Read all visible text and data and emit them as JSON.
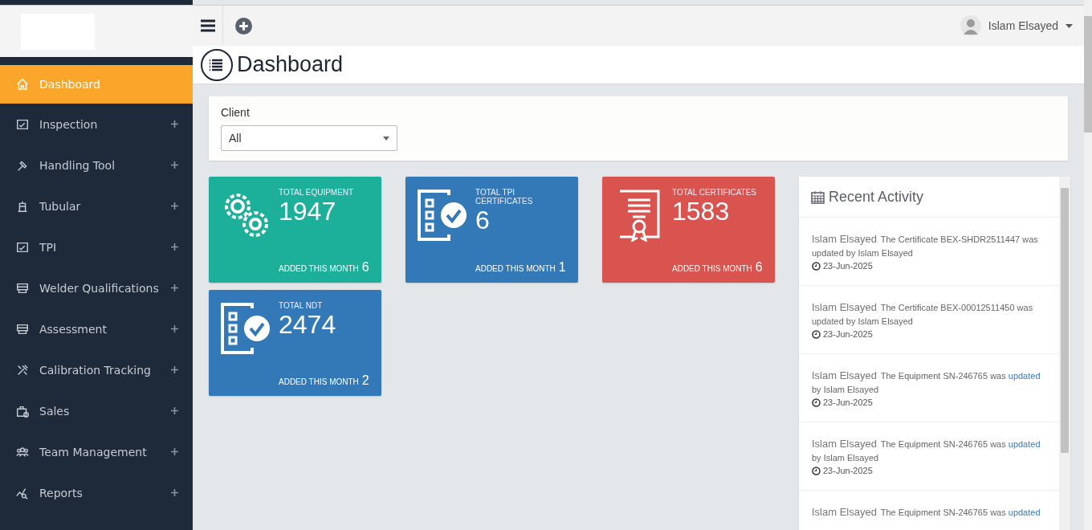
{
  "sidebar": {
    "items": [
      {
        "label": "Dashboard",
        "selected": true,
        "expandable": false
      },
      {
        "label": "Inspection",
        "selected": false,
        "expandable": true
      },
      {
        "label": "Handling Tool",
        "selected": false,
        "expandable": true
      },
      {
        "label": "Tubular",
        "selected": false,
        "expandable": true
      },
      {
        "label": "TPI",
        "selected": false,
        "expandable": true
      },
      {
        "label": "Welder Qualifications",
        "selected": false,
        "expandable": true
      },
      {
        "label": "Assessment",
        "selected": false,
        "expandable": true
      },
      {
        "label": "Calibration Tracking",
        "selected": false,
        "expandable": true
      },
      {
        "label": "Sales",
        "selected": false,
        "expandable": true
      },
      {
        "label": "Team Management",
        "selected": false,
        "expandable": true
      },
      {
        "label": "Reports",
        "selected": false,
        "expandable": true
      }
    ]
  },
  "topbar": {
    "user": "Islam Elsayed"
  },
  "page_title": "Dashboard",
  "filter": {
    "label": "Client",
    "value": "All"
  },
  "stats": [
    {
      "kind": "gears",
      "color": "#1cb09a",
      "title": "TOTAL EQUIPMENT",
      "value": "1947",
      "added_label": "ADDED THIS MONTH",
      "added": "6"
    },
    {
      "kind": "checklist",
      "color": "#3479b7",
      "title": "TOTAL TPI CERTIFICATES",
      "value": "6",
      "added_label": "ADDED THIS MONTH",
      "added": "1"
    },
    {
      "kind": "certificate",
      "color": "#d9534f",
      "title": "TOTAL CERTIFICATES",
      "value": "1583",
      "added_label": "ADDED THIS MONTH",
      "added": "6"
    },
    {
      "kind": "checklist",
      "color": "#3479b7",
      "title": "TOTAL NDT",
      "value": "2474",
      "added_label": "ADDED THIS MONTH",
      "added": "2"
    }
  ],
  "activity": {
    "title": "Recent Activity",
    "items": [
      {
        "user": "Islam Elsayed",
        "parts": [
          {
            "kind": "plain",
            "text": "The Certificate BEX-SHDR2511447 was updated by Islam Elsayed"
          }
        ],
        "date": "23-Jun-2025"
      },
      {
        "user": "Islam Elsayed",
        "parts": [
          {
            "kind": "plain",
            "text": "The Certificate BEX-00012511450 was updated by Islam Elsayed"
          }
        ],
        "date": "23-Jun-2025"
      },
      {
        "user": "Islam Elsayed",
        "parts": [
          {
            "kind": "plain",
            "text": "The Equipment SN-246765 was"
          },
          {
            "kind": "link",
            "text": "updated"
          },
          {
            "kind": "plain",
            "text": "by Islam Elsayed"
          }
        ],
        "date": "23-Jun-2025"
      },
      {
        "user": "Islam Elsayed",
        "parts": [
          {
            "kind": "plain",
            "text": "The Equipment SN-246765 was"
          },
          {
            "kind": "link",
            "text": "updated"
          },
          {
            "kind": "plain",
            "text": "by Islam Elsayed"
          }
        ],
        "date": "23-Jun-2025"
      },
      {
        "user": "Islam Elsayed",
        "parts": [
          {
            "kind": "plain",
            "text": "The Equipment SN-246765 was"
          },
          {
            "kind": "link",
            "text": "updated"
          }
        ]
      }
    ]
  }
}
